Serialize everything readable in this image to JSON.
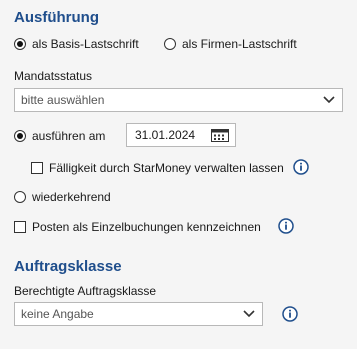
{
  "execution": {
    "title": "Ausführung",
    "type_options": [
      {
        "label": "als Basis-Lastschrift",
        "checked": true
      },
      {
        "label": "als Firmen-Lastschrift",
        "checked": false
      }
    ],
    "mandate_status": {
      "label": "Mandatsstatus",
      "value": "bitte auswählen"
    },
    "execute_on": {
      "label": "ausführen am",
      "checked": true,
      "date": "31.01.2024"
    },
    "due_date_checkbox": {
      "label": "Fälligkeit durch StarMoney verwalten lassen",
      "checked": false
    },
    "recurring": {
      "label": "wiederkehrend",
      "checked": false
    },
    "single_bookings_checkbox": {
      "label": "Posten als Einzelbuchungen kennzeichnen",
      "checked": false
    }
  },
  "order_class": {
    "title": "Auftragsklasse",
    "label": "Berechtigte Auftragsklasse",
    "value": "keine Angabe"
  },
  "icons": {
    "info": "info-icon",
    "chevron": "chevron-down-icon",
    "calendar": "calendar-icon"
  },
  "colors": {
    "accent": "#1f4e8c",
    "background": "#f5f5f5"
  }
}
